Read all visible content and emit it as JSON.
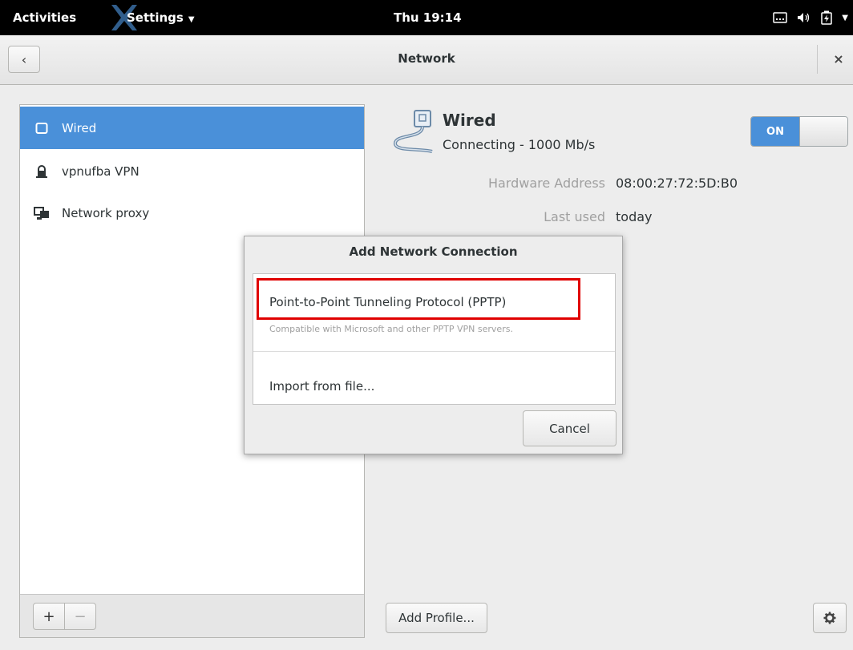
{
  "topbar": {
    "activities": "Activities",
    "app_menu": "Settings",
    "app_menu_arrow": "▼",
    "clock": "Thu 19:14"
  },
  "header": {
    "back_icon": "‹",
    "title": "Network",
    "close_icon": "×"
  },
  "sidebar": {
    "items": [
      {
        "label": "Wired",
        "icon": "wired-icon",
        "selected": true
      },
      {
        "label": "vpnufba VPN",
        "icon": "vpn-lock-icon",
        "selected": false
      },
      {
        "label": "Network proxy",
        "icon": "proxy-icon",
        "selected": false
      }
    ],
    "add_label": "+",
    "remove_label": "−"
  },
  "main": {
    "title": "Wired",
    "status": "Connecting - 1000 Mb/s",
    "toggle_label": "ON",
    "details": [
      {
        "label": "Hardware Address",
        "value": "08:00:27:72:5D:B0"
      },
      {
        "label": "Last used",
        "value": "today"
      }
    ],
    "add_profile": "Add Profile..."
  },
  "dialog": {
    "title": "Add Network Connection",
    "options": [
      {
        "name": "Point-to-Point Tunneling Protocol (PPTP)",
        "description": "Compatible with Microsoft and other PPTP VPN servers."
      },
      {
        "name": "Import from file..."
      }
    ],
    "cancel": "Cancel"
  },
  "colors": {
    "accent": "#4a90d9",
    "highlight": "#e00000",
    "topbar": "#000000"
  }
}
